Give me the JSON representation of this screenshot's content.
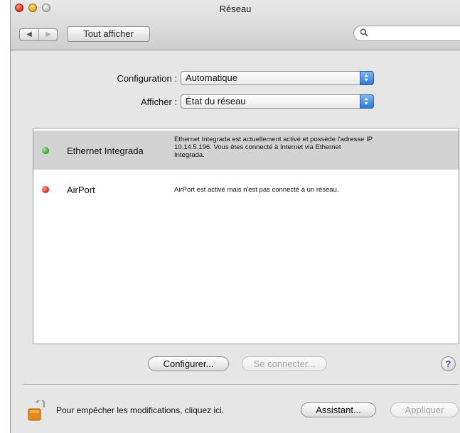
{
  "window": {
    "title": "Réseau"
  },
  "toolbar": {
    "back_glyph": "◀",
    "forward_glyph": "▶",
    "show_all_label": "Tout afficher",
    "search_placeholder": "",
    "search_icon": "magnifier-icon"
  },
  "form": {
    "configuration_label": "Configuration :",
    "configuration_value": "Automatique",
    "show_label": "Afficher :",
    "show_value": "État du réseau"
  },
  "services": [
    {
      "name": "Ethernet Integrada",
      "status_color": "#2f9a2a",
      "description_lines": [
        "Ethernet Integrada est actuellement activé et possède l'adresse IP",
        "10.14.5.196. Vous êtes connecté à Internet via Ethernet",
        "Integrada."
      ],
      "selected": true
    },
    {
      "name": "AirPort",
      "status_color": "#d4201a",
      "description_lines": [
        "AirPort est activé mais n'est pas connecté à un réseau."
      ],
      "selected": false
    }
  ],
  "buttons": {
    "configure_label": "Configurer...",
    "connect_label": "Se connecter...",
    "help_label": "?",
    "assistant_label": "Assistant...",
    "apply_label": "Appliquer"
  },
  "footer": {
    "lock_message": "Pour empêcher les modifications, cliquez ici.",
    "lock_icon": "lock-icon"
  },
  "colors": {
    "accent_blue": "#2f78d3",
    "selected_row": "#d3d3d3",
    "window_bg": "#e6e6e6"
  }
}
